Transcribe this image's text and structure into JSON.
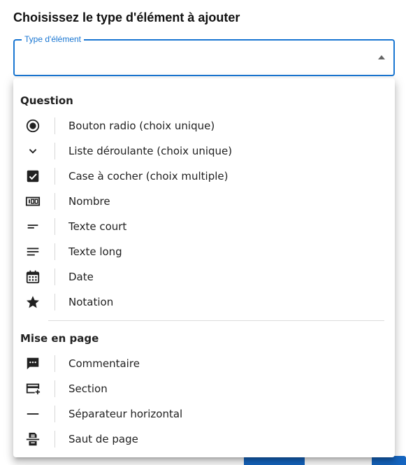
{
  "dialog": {
    "title": "Choisissez le type d'élément à ajouter"
  },
  "select": {
    "label": "Type d'élément",
    "value": ""
  },
  "menu": {
    "groups": [
      {
        "header": "Question",
        "items": [
          {
            "label": "Bouton radio (choix unique)",
            "icon": "radio-button-icon"
          },
          {
            "label": "Liste déroulante (choix unique)",
            "icon": "chevron-down-icon"
          },
          {
            "label": "Case à cocher (choix multiple)",
            "icon": "checkbox-icon"
          },
          {
            "label": "Nombre",
            "icon": "number-icon"
          },
          {
            "label": "Texte court",
            "icon": "short-text-icon"
          },
          {
            "label": "Texte long",
            "icon": "long-text-icon"
          },
          {
            "label": "Date",
            "icon": "calendar-icon"
          },
          {
            "label": "Notation",
            "icon": "star-icon"
          }
        ]
      },
      {
        "header": "Mise en page",
        "items": [
          {
            "label": "Commentaire",
            "icon": "comment-icon"
          },
          {
            "label": "Section",
            "icon": "section-add-icon"
          },
          {
            "label": "Séparateur horizontal",
            "icon": "horizontal-rule-icon"
          },
          {
            "label": "Saut de page",
            "icon": "page-break-icon"
          }
        ]
      }
    ]
  },
  "colors": {
    "accent": "#1976d2",
    "button": "#1565c0"
  }
}
